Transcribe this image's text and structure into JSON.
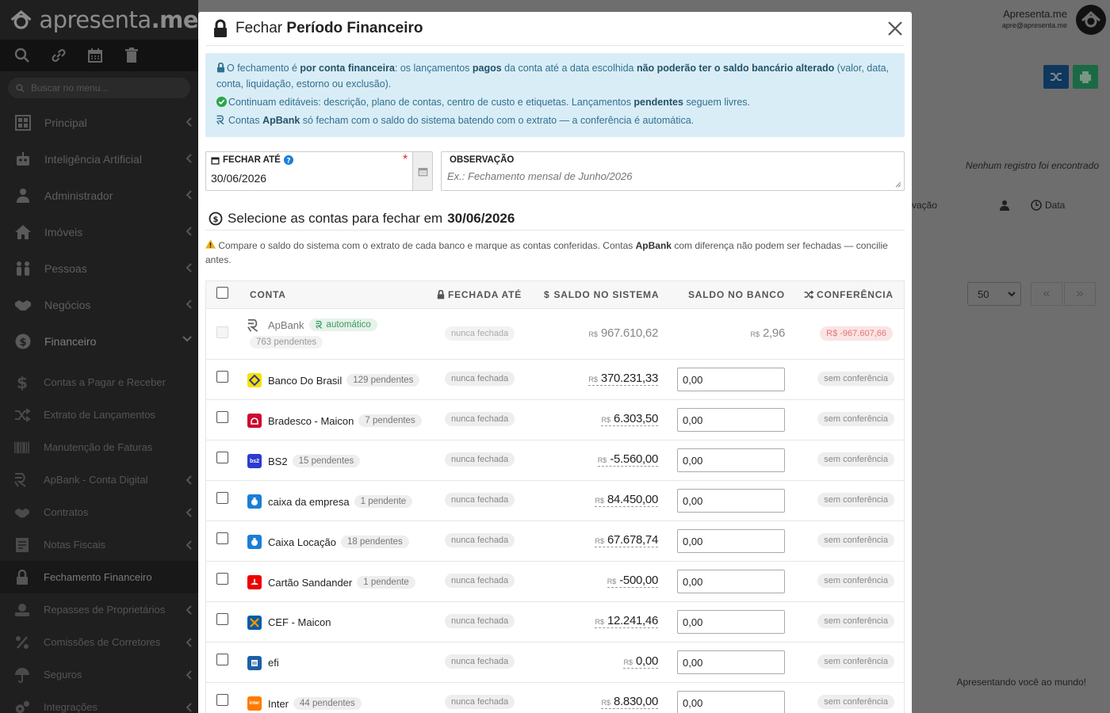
{
  "app": {
    "logo_text": "apresenta",
    "logo_suffix": ".me"
  },
  "sidebar": {
    "search_placeholder": "Buscar no menu...",
    "menu": [
      {
        "label": "Principal",
        "icon": "dashboard-icon"
      },
      {
        "label": "Inteligência Artificial",
        "icon": "robot-icon"
      },
      {
        "label": "Administrador",
        "icon": "user-shield-icon"
      },
      {
        "label": "Imóveis",
        "icon": "home-icon"
      },
      {
        "label": "Pessoas",
        "icon": "people-icon"
      },
      {
        "label": "Negócios",
        "icon": "handshake-icon"
      },
      {
        "label": "Financeiro",
        "icon": "dollar-icon"
      }
    ],
    "submenu": [
      {
        "label": "Contas a Pagar e Receber",
        "icon": "dollar-icon"
      },
      {
        "label": "Extrato de Lançamentos",
        "icon": "shuffle-icon"
      },
      {
        "label": "Manutenção de Faturas",
        "icon": "barcode-icon"
      },
      {
        "label": "ApBank - Conta Digital",
        "icon": "apbank-icon"
      },
      {
        "label": "Contratos",
        "icon": "handshake-icon"
      },
      {
        "label": "Notas Fiscais",
        "icon": "invoice-icon"
      },
      {
        "label": "Fechamento Financeiro",
        "icon": "lock-icon"
      },
      {
        "label": "Repasses de Proprietários",
        "icon": "transfer-icon"
      },
      {
        "label": "Comissões de Corretores",
        "icon": "percent-icon"
      },
      {
        "label": "Seguros",
        "icon": "umbrella-icon"
      },
      {
        "label": "Integrações",
        "icon": "gears-icon"
      }
    ]
  },
  "background": {
    "user_name": "Apresenta.me",
    "user_email": "apre@apresenta.me",
    "empty_text": "Nenhum registro foi encontrado",
    "col_obs": "vação",
    "col_data": "Data",
    "per_page": "50",
    "footer": "Apresentando você ao mundo!"
  },
  "modal": {
    "title_prefix": "Fechar",
    "title_bold": "Período Financeiro",
    "info": {
      "l1_a": "O fechamento é ",
      "l1_b": "por conta financeira",
      "l1_c": ": os lançamentos ",
      "l1_d": "pagos",
      "l1_e": " da conta até a data escolhida ",
      "l1_f": "não poderão ter o saldo bancário alterado",
      "l1_g": " (valor, data, conta, liquidação, estorno ou exclusão).",
      "l2_a": "Continuam editáveis: descrição, plano de contas, centro de custo e etiquetas. Lançamentos ",
      "l2_b": "pendentes",
      "l2_c": " seguem livres.",
      "l3_a": "Contas ",
      "l3_b": "ApBank",
      "l3_c": " só fecham com o saldo do sistema batendo com o extrato — a conferência é automática."
    },
    "date_label": "FECHAR ATÉ",
    "date_value": "30/06/2026",
    "obs_label": "OBSERVAÇÃO",
    "obs_placeholder": "Ex.: Fechamento mensal de Junho/2026",
    "section_prefix": "Selecione as contas para fechar em",
    "section_date": "30/06/2026",
    "warn_a": "Compare o saldo do sistema com o extrato de cada banco e marque as contas conferidas. Contas ",
    "warn_b": "ApBank",
    "warn_c": " com diferença não podem ser fechadas — concilie antes.",
    "table": {
      "col_conta": "CONTA",
      "col_fechada": "FECHADA ATÉ",
      "col_saldo_sis": "SALDO NO SISTEMA",
      "col_saldo_banco": "SALDO NO BANCO",
      "col_conf": "CONFERÊNCIA",
      "currency": "R$",
      "apbank": {
        "name": "ApBank",
        "auto": "automático",
        "pend": "763 pendentes",
        "fechada": "nunca fechada",
        "saldo": "967.610,62",
        "banco": "2,96",
        "diff": "R$ -967.607,66"
      },
      "rows": [
        {
          "name": "Banco Do Brasil",
          "pend": "129 pendentes",
          "fechada": "nunca fechada",
          "saldo": "370.231,33",
          "banco": "0,00",
          "conf": "sem conferência",
          "color": "#f8e000",
          "icon": "banco-do-brasil-icon"
        },
        {
          "name": "Bradesco - Maicon",
          "pend": "7 pendentes",
          "fechada": "nunca fechada",
          "saldo": "6.303,50",
          "banco": "0,00",
          "conf": "sem conferência",
          "color": "#cc092f",
          "icon": "bradesco-icon"
        },
        {
          "name": "BS2",
          "pend": "15 pendentes",
          "fechada": "nunca fechada",
          "saldo": "-5.560,00",
          "banco": "0,00",
          "conf": "sem conferência",
          "color": "#2b3bd1",
          "icon": "bs2-icon"
        },
        {
          "name": "caixa da empresa",
          "pend": "1 pendente",
          "fechada": "nunca fechada",
          "saldo": "84.450,00",
          "banco": "0,00",
          "conf": "sem conferência",
          "color": "#1a7fd6",
          "icon": "money-bag-icon"
        },
        {
          "name": "Caixa Locação",
          "pend": "18 pendentes",
          "fechada": "nunca fechada",
          "saldo": "67.678,74",
          "banco": "0,00",
          "conf": "sem conferência",
          "color": "#1a7fd6",
          "icon": "money-bag-icon"
        },
        {
          "name": "Cartão Sandander",
          "pend": "1 pendente",
          "fechada": "nunca fechada",
          "saldo": "-500,00",
          "banco": "0,00",
          "conf": "sem conferência",
          "color": "#ec0000",
          "icon": "santander-icon"
        },
        {
          "name": "CEF - Maicon",
          "pend": "",
          "fechada": "nunca fechada",
          "saldo": "12.241,46",
          "banco": "0,00",
          "conf": "sem conferência",
          "color": "#005ca9",
          "icon": "caixa-icon"
        },
        {
          "name": "efi",
          "pend": "",
          "fechada": "nunca fechada",
          "saldo": "0,00",
          "banco": "0,00",
          "conf": "sem conferência",
          "color": "#1d5fa6",
          "icon": "bank-icon"
        },
        {
          "name": "Inter",
          "pend": "44 pendentes",
          "fechada": "nunca fechada",
          "saldo": "8.830,00",
          "banco": "0,00",
          "conf": "sem conferência",
          "color": "#ff7a00",
          "icon": "inter-icon"
        }
      ]
    }
  }
}
